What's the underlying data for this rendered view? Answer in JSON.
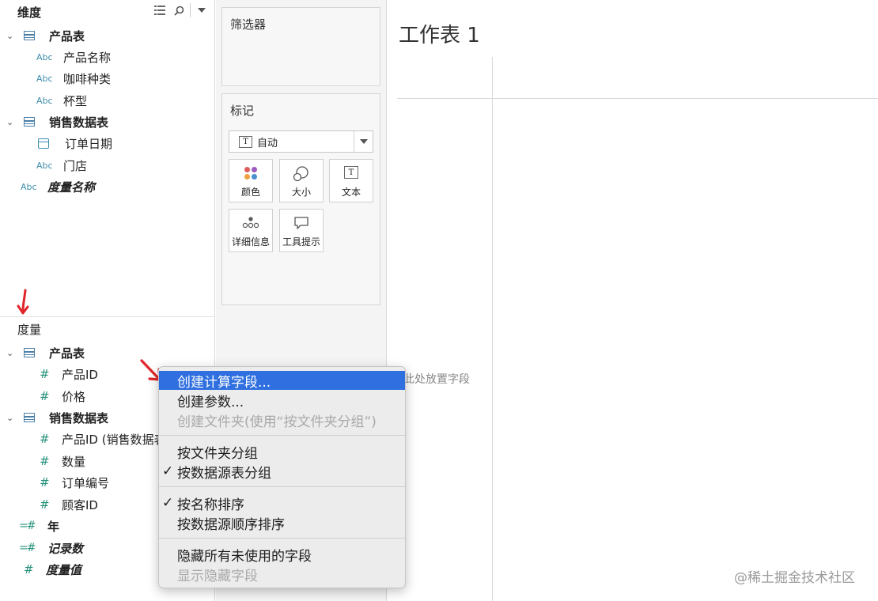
{
  "dimensions": {
    "header": "维度",
    "groups": [
      {
        "name": "产品表",
        "fields": [
          "产品名称",
          "咖啡种类",
          "杯型"
        ]
      },
      {
        "name": "销售数据表",
        "fields": [
          "订单日期",
          "门店"
        ]
      }
    ],
    "measure_names": "度量名称"
  },
  "measures": {
    "header": "度量",
    "groups": [
      {
        "name": "产品表",
        "fields": [
          "产品ID",
          "价格"
        ]
      },
      {
        "name": "销售数据表",
        "fields": [
          "产品ID (销售数据表)",
          "数量",
          "订单编号",
          "顾客ID"
        ]
      }
    ],
    "extra": [
      "年",
      "记录数",
      "度量值"
    ]
  },
  "icons": {
    "abc": "Abc",
    "hash": "#",
    "equal_hash": "=#",
    "text_t": "T"
  },
  "shelves": {
    "filters_title": "筛选器",
    "marks_title": "标记",
    "mark_type": "自动",
    "buttons": [
      "颜色",
      "大小",
      "文本",
      "详细信息",
      "工具提示"
    ]
  },
  "canvas": {
    "sheet_title": "工作表 1",
    "drop_hint": "在此处放置字段",
    "watermark": "@稀土掘金技术社区"
  },
  "context_menu": {
    "items": [
      {
        "label": "创建计算字段...",
        "state": "highlighted",
        "checked": false
      },
      {
        "label": "创建参数...",
        "state": "normal",
        "checked": false
      },
      {
        "label": "创建文件夹(使用“按文件夹分组”)",
        "state": "disabled",
        "checked": false
      },
      {
        "label": "按文件夹分组",
        "state": "normal",
        "checked": false
      },
      {
        "label": "按数据源表分组",
        "state": "normal",
        "checked": true
      },
      {
        "label": "按名称排序",
        "state": "normal",
        "checked": true
      },
      {
        "label": "按数据源顺序排序",
        "state": "normal",
        "checked": false
      },
      {
        "label": "隐藏所有未使用的字段",
        "state": "normal",
        "checked": false
      },
      {
        "label": "显示隐藏字段",
        "state": "disabled",
        "checked": false
      }
    ]
  },
  "colors": {
    "highlight": "#2f6fe0",
    "arrow": "#e0262a",
    "dim_icon": "#3d8eae",
    "measure_icon": "#23907a"
  }
}
